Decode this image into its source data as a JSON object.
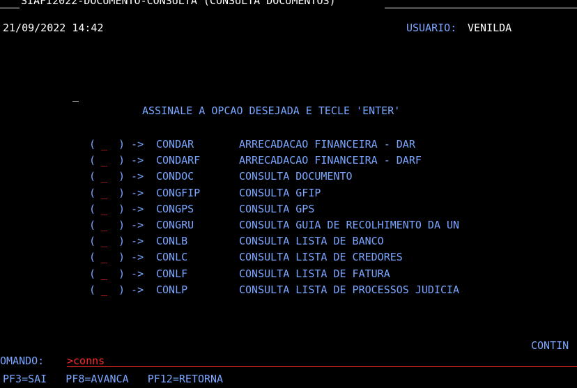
{
  "header": {
    "title": "SIAFI2022-DOCUMENTO-CONSULTA (CONSULTA DOCUMENTOS)",
    "datetime": "21/09/2022 14:42",
    "user_label": "USUARIO:",
    "user_name": "VENILDA"
  },
  "cursor": "_",
  "instruction": "ASSINALE A OPCAO DESEJADA E TECLE 'ENTER'",
  "menu": {
    "open_paren": "(",
    "blank": "_",
    "close_arrow": ") ->",
    "items": [
      {
        "code": "CONDAR",
        "description": "ARRECADACAO FINANCEIRA - DAR"
      },
      {
        "code": "CONDARF",
        "description": "ARRECADACAO FINANCEIRA - DARF"
      },
      {
        "code": "CONDOC",
        "description": "CONSULTA DOCUMENTO"
      },
      {
        "code": "CONGFIP",
        "description": "CONSULTA GFIP"
      },
      {
        "code": "CONGPS",
        "description": "CONSULTA GPS"
      },
      {
        "code": "CONGRU",
        "description": "CONSULTA GUIA DE RECOLHIMENTO DA UN"
      },
      {
        "code": "CONLB",
        "description": "CONSULTA LISTA DE BANCO"
      },
      {
        "code": "CONLC",
        "description": "CONSULTA LISTA DE CREDORES"
      },
      {
        "code": "CONLF",
        "description": "CONSULTA LISTA DE FATURA"
      },
      {
        "code": "CONLP",
        "description": "CONSULTA LISTA DE PROCESSOS JUDICIA"
      }
    ]
  },
  "continue_label": "CONTIN",
  "command": {
    "label": "OMANDO:",
    "value": ">conns"
  },
  "function_keys": "PF3=SAI   PF8=AVANCA   PF12=RETORNA",
  "colors": {
    "background": "#000000",
    "text_white": "#ffffff",
    "text_blue": "#7aa6ff",
    "text_red": "#ff2a2a"
  }
}
